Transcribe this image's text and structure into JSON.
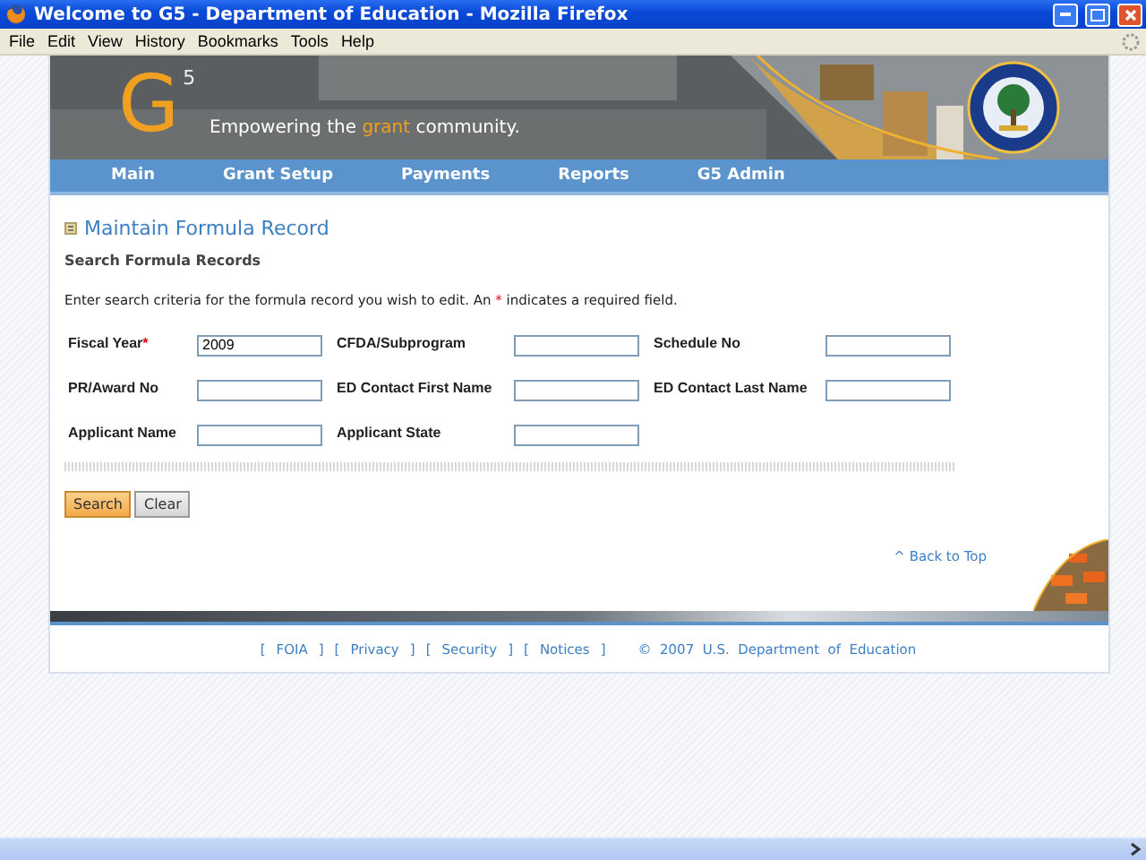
{
  "window": {
    "title": "Welcome to G5 - Department of Education - Mozilla Firefox"
  },
  "menu": [
    "File",
    "Edit",
    "View",
    "History",
    "Bookmarks",
    "Tools",
    "Help"
  ],
  "banner": {
    "logo_letter": "G",
    "logo_superscript": "5",
    "tagline_before": "Empowering the ",
    "tagline_highlight": "grant",
    "tagline_after": " community."
  },
  "nav": [
    "Main",
    "Grant Setup",
    "Payments",
    "Reports",
    "G5 Admin"
  ],
  "page": {
    "title": "Maintain Formula Record",
    "subtitle": "Search Formula Records",
    "instructions_before": "Enter search criteria for the formula record you wish to edit. An ",
    "required_mark": "*",
    "instructions_after": " indicates a required field."
  },
  "fields": [
    {
      "label": "Fiscal Year",
      "required": true,
      "value": "2009"
    },
    {
      "label": "CFDA/Subprogram",
      "required": false
    },
    {
      "label": "Schedule No",
      "required": false
    },
    {
      "label": "PR/Award No",
      "required": false
    },
    {
      "label": "ED Contact First Name",
      "required": false
    },
    {
      "label": "ED Contact Last Name",
      "required": false
    },
    {
      "label": "Applicant Name",
      "required": false
    },
    {
      "label": "Applicant State",
      "required": false
    }
  ],
  "buttons": [
    {
      "label": "Search",
      "kind": "primary"
    },
    {
      "label": "Clear",
      "kind": "secondary"
    }
  ],
  "back_to_top": "^ Back to Top",
  "footer": {
    "links": [
      {
        "open": "[",
        "label": "FOIA",
        "close": "]"
      },
      {
        "open": "[",
        "label": "Privacy",
        "close": "]"
      },
      {
        "open": "[",
        "label": "Security",
        "close": "]"
      },
      {
        "open": "[",
        "label": "Notices",
        "close": "]"
      }
    ],
    "copyright": "©  2007  U.S.  Department  of  Education"
  }
}
